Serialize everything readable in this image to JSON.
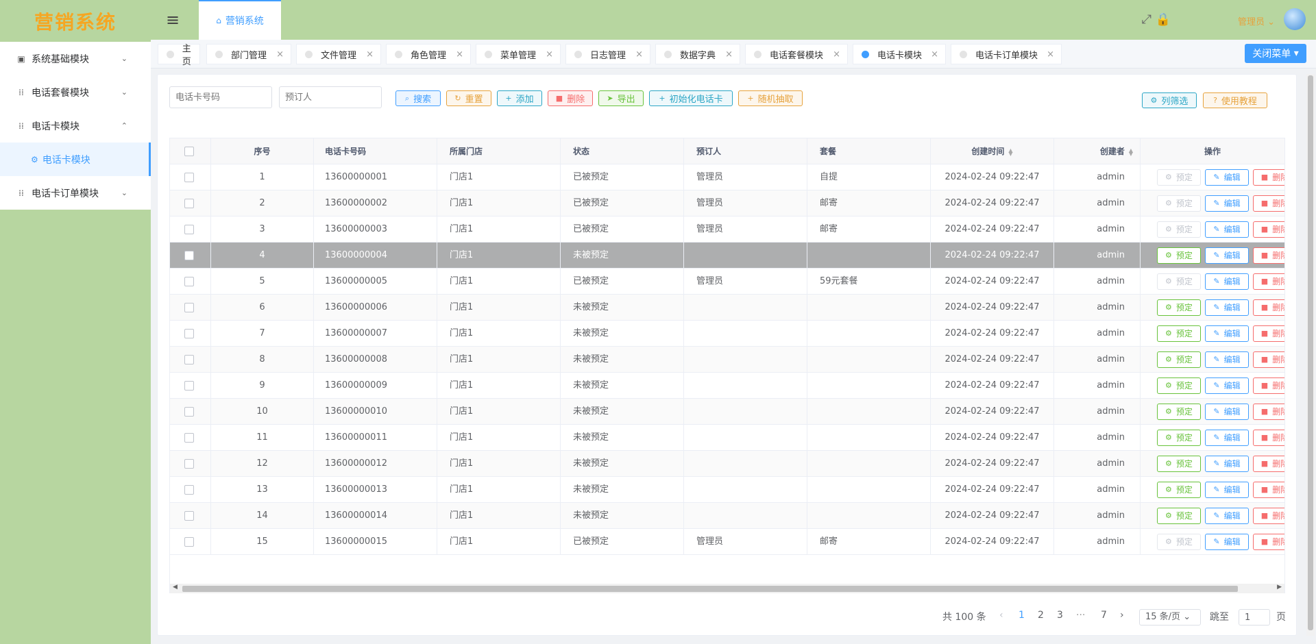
{
  "logo": "营销系统",
  "sidebar": {
    "items": [
      {
        "label": "系统基础模块",
        "icon": "chart-icon",
        "chevron": "⌄"
      },
      {
        "label": "电话套餐模块",
        "icon": "grid-icon",
        "chevron": "⌄"
      },
      {
        "label": "电话卡模块",
        "icon": "grid-icon",
        "chevron": "⌃"
      },
      {
        "label": "电话卡订单模块",
        "icon": "grid-icon",
        "chevron": "⌄"
      }
    ],
    "sub": {
      "label": "电话卡模块",
      "icon": "gear-icon"
    }
  },
  "header": {
    "tab": "营销系统",
    "user": "管理员"
  },
  "tags": [
    {
      "label": "主页",
      "close": false
    },
    {
      "label": "部门管理",
      "close": true
    },
    {
      "label": "文件管理",
      "close": true
    },
    {
      "label": "角色管理",
      "close": true
    },
    {
      "label": "菜单管理",
      "close": true
    },
    {
      "label": "日志管理",
      "close": true
    },
    {
      "label": "数据字典",
      "close": true
    },
    {
      "label": "电话套餐模块",
      "close": true
    },
    {
      "label": "电话卡模块",
      "close": true,
      "active": true
    },
    {
      "label": "电话卡订单模块",
      "close": true
    }
  ],
  "close_menu": "关闭菜单",
  "toolbar": {
    "phone_placeholder": "电话卡号码",
    "booker_placeholder": "预订人",
    "search": "搜索",
    "reset": "重置",
    "add": "添加",
    "delete": "删除",
    "export": "导出",
    "init": "初始化电话卡",
    "random": "随机抽取",
    "filter": "列筛选",
    "tutorial": "使用教程"
  },
  "table": {
    "headers": [
      "序号",
      "电话卡号码",
      "所属门店",
      "状态",
      "预订人",
      "套餐",
      "创建时间",
      "创建者",
      "操作"
    ],
    "actions": {
      "reserve": "预定",
      "edit": "编辑",
      "delete": "删除"
    },
    "rows": [
      {
        "no": "1",
        "phone": "13600000001",
        "store": "门店1",
        "status": "已被预定",
        "booker": "管理员",
        "pkg": "自提",
        "time": "2024-02-24 09:22:47",
        "creator": "admin",
        "reserved": true
      },
      {
        "no": "2",
        "phone": "13600000002",
        "store": "门店1",
        "status": "已被预定",
        "booker": "管理员",
        "pkg": "邮寄",
        "time": "2024-02-24 09:22:47",
        "creator": "admin",
        "reserved": true
      },
      {
        "no": "3",
        "phone": "13600000003",
        "store": "门店1",
        "status": "已被预定",
        "booker": "管理员",
        "pkg": "邮寄",
        "time": "2024-02-24 09:22:47",
        "creator": "admin",
        "reserved": true
      },
      {
        "no": "4",
        "phone": "13600000004",
        "store": "门店1",
        "status": "未被预定",
        "booker": "",
        "pkg": "",
        "time": "2024-02-24 09:22:47",
        "creator": "admin",
        "reserved": false,
        "highlight": true
      },
      {
        "no": "5",
        "phone": "13600000005",
        "store": "门店1",
        "status": "已被预定",
        "booker": "管理员",
        "pkg": "59元套餐",
        "time": "2024-02-24 09:22:47",
        "creator": "admin",
        "reserved": true
      },
      {
        "no": "6",
        "phone": "13600000006",
        "store": "门店1",
        "status": "未被预定",
        "booker": "",
        "pkg": "",
        "time": "2024-02-24 09:22:47",
        "creator": "admin",
        "reserved": false
      },
      {
        "no": "7",
        "phone": "13600000007",
        "store": "门店1",
        "status": "未被预定",
        "booker": "",
        "pkg": "",
        "time": "2024-02-24 09:22:47",
        "creator": "admin",
        "reserved": false
      },
      {
        "no": "8",
        "phone": "13600000008",
        "store": "门店1",
        "status": "未被预定",
        "booker": "",
        "pkg": "",
        "time": "2024-02-24 09:22:47",
        "creator": "admin",
        "reserved": false
      },
      {
        "no": "9",
        "phone": "13600000009",
        "store": "门店1",
        "status": "未被预定",
        "booker": "",
        "pkg": "",
        "time": "2024-02-24 09:22:47",
        "creator": "admin",
        "reserved": false
      },
      {
        "no": "10",
        "phone": "13600000010",
        "store": "门店1",
        "status": "未被预定",
        "booker": "",
        "pkg": "",
        "time": "2024-02-24 09:22:47",
        "creator": "admin",
        "reserved": false
      },
      {
        "no": "11",
        "phone": "13600000011",
        "store": "门店1",
        "status": "未被预定",
        "booker": "",
        "pkg": "",
        "time": "2024-02-24 09:22:47",
        "creator": "admin",
        "reserved": false
      },
      {
        "no": "12",
        "phone": "13600000012",
        "store": "门店1",
        "status": "未被预定",
        "booker": "",
        "pkg": "",
        "time": "2024-02-24 09:22:47",
        "creator": "admin",
        "reserved": false
      },
      {
        "no": "13",
        "phone": "13600000013",
        "store": "门店1",
        "status": "未被预定",
        "booker": "",
        "pkg": "",
        "time": "2024-02-24 09:22:47",
        "creator": "admin",
        "reserved": false
      },
      {
        "no": "14",
        "phone": "13600000014",
        "store": "门店1",
        "status": "未被预定",
        "booker": "",
        "pkg": "",
        "time": "2024-02-24 09:22:47",
        "creator": "admin",
        "reserved": false
      },
      {
        "no": "15",
        "phone": "13600000015",
        "store": "门店1",
        "status": "已被预定",
        "booker": "管理员",
        "pkg": "邮寄",
        "time": "2024-02-24 09:22:47",
        "creator": "admin",
        "reserved": true
      }
    ]
  },
  "pagination": {
    "total": "共 100 条",
    "pages": [
      "1",
      "2",
      "3",
      "···",
      "7"
    ],
    "current": "1",
    "page_size": "15 条/页",
    "goto_label": "跳至",
    "goto_value": "1",
    "page_suffix": "页"
  }
}
